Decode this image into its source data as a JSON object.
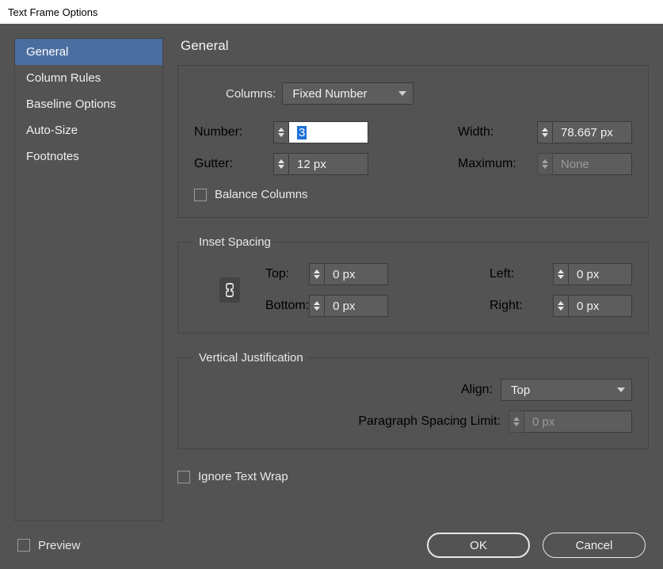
{
  "window": {
    "title": "Text Frame Options"
  },
  "sidebar": {
    "items": [
      {
        "label": "General",
        "active": true
      },
      {
        "label": "Column Rules"
      },
      {
        "label": "Baseline Options"
      },
      {
        "label": "Auto-Size"
      },
      {
        "label": "Footnotes"
      }
    ]
  },
  "page": {
    "title": "General"
  },
  "columns": {
    "label": "Columns:",
    "mode": "Fixed Number",
    "number_label": "Number:",
    "number_value": "3",
    "width_label": "Width:",
    "width_value": "78.667 px",
    "gutter_label": "Gutter:",
    "gutter_value": "12 px",
    "maximum_label": "Maximum:",
    "maximum_value": "None",
    "balance_label": "Balance Columns"
  },
  "inset": {
    "legend": "Inset Spacing",
    "top_label": "Top:",
    "top_value": "0 px",
    "bottom_label": "Bottom:",
    "bottom_value": "0 px",
    "left_label": "Left:",
    "left_value": "0 px",
    "right_label": "Right:",
    "right_value": "0 px"
  },
  "vj": {
    "legend": "Vertical Justification",
    "align_label": "Align:",
    "align_value": "Top",
    "psl_label": "Paragraph Spacing Limit:",
    "psl_value": "0 px"
  },
  "ignore_wrap_label": "Ignore Text Wrap",
  "footer": {
    "preview_label": "Preview",
    "ok_label": "OK",
    "cancel_label": "Cancel"
  }
}
